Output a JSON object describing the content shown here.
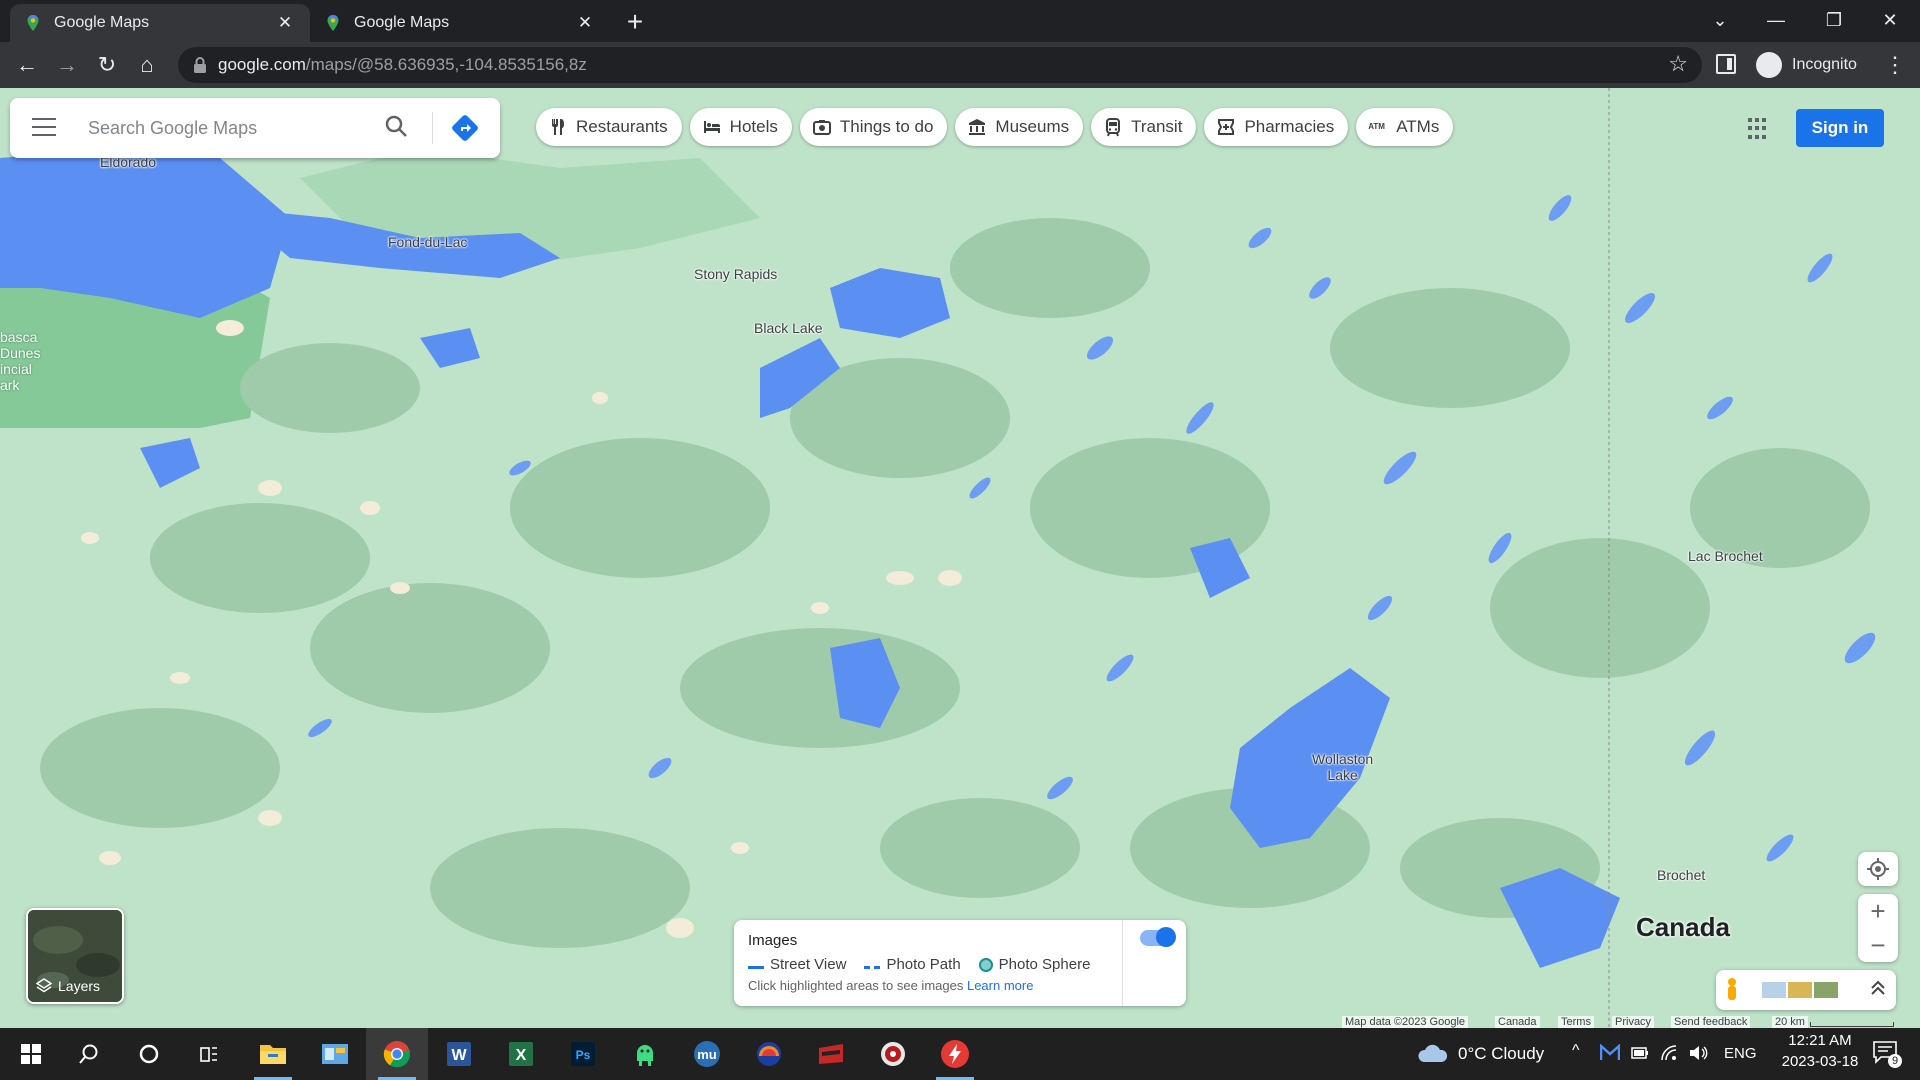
{
  "browser": {
    "tabs": [
      {
        "title": "Google Maps",
        "active": true
      },
      {
        "title": "Google Maps",
        "active": false
      }
    ],
    "url_domain": "google.com",
    "url_path": "/maps/@58.636935,-104.8535156,8z",
    "profile_label": "Incognito"
  },
  "maps": {
    "search_placeholder": "Search Google Maps",
    "chips": [
      "Restaurants",
      "Hotels",
      "Things to do",
      "Museums",
      "Transit",
      "Pharmacies",
      "ATMs"
    ],
    "atm_glyph": "ATM",
    "sign_in": "Sign in",
    "places": {
      "eldorado": "Eldorado",
      "fond_du_lac": "Fond-du-Lac",
      "stony_rapids": "Stony Rapids",
      "black_lake": "Black Lake",
      "park_line1": "basca",
      "park_line2": "Dunes",
      "park_line3": "incial",
      "park_line4": "ark",
      "lac_brochet": "Lac Brochet",
      "wollaston_line1": "Wollaston",
      "wollaston_line2": "Lake",
      "brochet": "Brochet",
      "country": "Canada"
    },
    "layers_label": "Layers",
    "images_card": {
      "title": "Images",
      "street_view": "Street View",
      "photo_path": "Photo Path",
      "photo_sphere": "Photo Sphere",
      "hint": "Click highlighted areas to see images",
      "learn_more": "Learn more",
      "toggle_on": true
    },
    "attribution": {
      "map_data": "Map data ©2023 Google",
      "region": "Canada",
      "terms": "Terms",
      "privacy": "Privacy",
      "feedback": "Send feedback",
      "scale": "20 km"
    },
    "colors": {
      "land": "#bfe3c9",
      "water": "#5b8ff2",
      "forest": "#98ccaa",
      "accent": "#1a73e8"
    }
  },
  "taskbar": {
    "weather": "0°C  Cloudy",
    "language": "ENG",
    "time": "12:21 AM",
    "date": "2023-03-18",
    "notifications": "9",
    "apps": [
      "start-icon",
      "search-icon",
      "cortana-icon",
      "task-view-icon",
      "file-explorer-icon",
      "control-panel-icon",
      "chrome-icon",
      "word-icon",
      "excel-icon",
      "photoshop-icon",
      "android-icon",
      "mu-icon",
      "colorful-app-icon",
      "app-icon-red",
      "media-player-icon",
      "flash-icon"
    ]
  }
}
